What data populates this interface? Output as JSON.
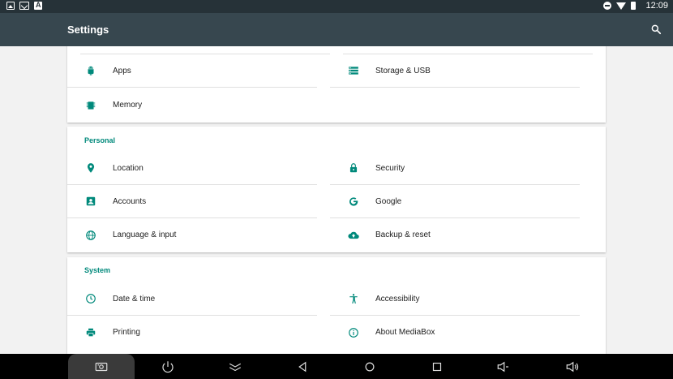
{
  "status_bar": {
    "time": "12:09"
  },
  "app_bar": {
    "title": "Settings"
  },
  "cards": {
    "device": {
      "items": [
        {
          "label": "Apps",
          "icon": "android-icon"
        },
        {
          "label": "Storage & USB",
          "icon": "storage-icon"
        },
        {
          "label": "Memory",
          "icon": "memory-icon"
        }
      ]
    },
    "personal": {
      "header": "Personal",
      "items": [
        {
          "label": "Location",
          "icon": "location-icon"
        },
        {
          "label": "Security",
          "icon": "lock-icon"
        },
        {
          "label": "Accounts",
          "icon": "account-icon"
        },
        {
          "label": "Google",
          "icon": "google-icon"
        },
        {
          "label": "Language & input",
          "icon": "globe-icon"
        },
        {
          "label": "Backup & reset",
          "icon": "cloud-upload-icon"
        }
      ]
    },
    "system": {
      "header": "System",
      "items": [
        {
          "label": "Date & time",
          "icon": "clock-icon"
        },
        {
          "label": "Accessibility",
          "icon": "accessibility-icon"
        },
        {
          "label": "Printing",
          "icon": "printer-icon"
        },
        {
          "label": "About MediaBox",
          "icon": "info-icon"
        }
      ]
    }
  },
  "colors": {
    "accent": "#00897b",
    "app_bar": "#37474f",
    "status_bar": "#263238"
  }
}
